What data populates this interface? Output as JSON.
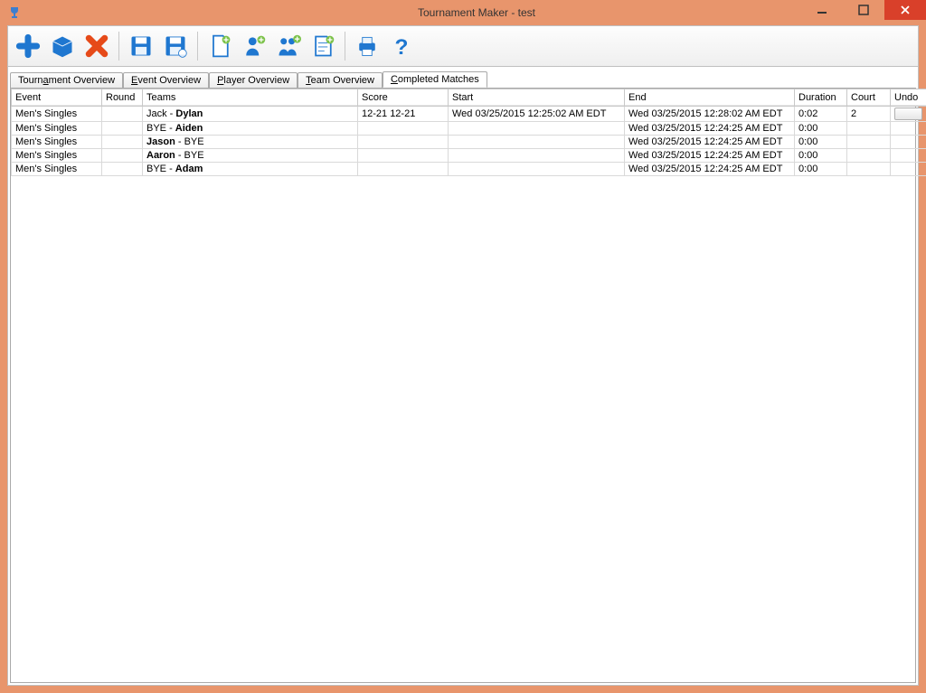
{
  "window": {
    "title": "Tournament Maker - test"
  },
  "toolbar": {
    "new_label": "New",
    "open_label": "Open",
    "delete_label": "Delete",
    "save_label": "Save",
    "save_as_label": "Save As",
    "new_doc_label": "New Document",
    "add_person_label": "Add Player",
    "add_team_label": "Add Team",
    "add_event_label": "Add Event",
    "print_label": "Print",
    "help_label": "Help"
  },
  "tabs": [
    {
      "label_pre": "Tourn",
      "label_ul": "a",
      "label_post": "ment Overview"
    },
    {
      "label_pre": "",
      "label_ul": "E",
      "label_post": "vent Overview"
    },
    {
      "label_pre": "",
      "label_ul": "P",
      "label_post": "layer Overview"
    },
    {
      "label_pre": "",
      "label_ul": "T",
      "label_post": "eam Overview"
    },
    {
      "label_pre": "",
      "label_ul": "C",
      "label_post": "ompleted Matches"
    }
  ],
  "active_tab_index": 4,
  "columns": {
    "event": "Event",
    "round": "Round",
    "teams": "Teams",
    "score": "Score",
    "start": "Start",
    "end": "End",
    "duration": "Duration",
    "court": "Court",
    "undo": "Undo"
  },
  "rows": [
    {
      "event": "Men's Singles",
      "round": "",
      "loser": "Jack",
      "winner": "Dylan",
      "score": "12-21 12-21",
      "start": "Wed 03/25/2015 12:25:02 AM EDT",
      "end": "Wed 03/25/2015 12:28:02 AM EDT",
      "duration": "0:02",
      "court": "2",
      "show_undo": true,
      "winner_first": false
    },
    {
      "event": "Men's Singles",
      "round": "",
      "loser": "BYE",
      "winner": "Aiden",
      "score": "",
      "start": "",
      "end": "Wed 03/25/2015 12:24:25 AM EDT",
      "duration": "0:00",
      "court": "",
      "show_undo": false,
      "winner_first": false
    },
    {
      "event": "Men's Singles",
      "round": "",
      "loser": "BYE",
      "winner": "Jason",
      "score": "",
      "start": "",
      "end": "Wed 03/25/2015 12:24:25 AM EDT",
      "duration": "0:00",
      "court": "",
      "show_undo": false,
      "winner_first": true
    },
    {
      "event": "Men's Singles",
      "round": "",
      "loser": "BYE",
      "winner": "Aaron",
      "score": "",
      "start": "",
      "end": "Wed 03/25/2015 12:24:25 AM EDT",
      "duration": "0:00",
      "court": "",
      "show_undo": false,
      "winner_first": true
    },
    {
      "event": "Men's Singles",
      "round": "",
      "loser": "BYE",
      "winner": "Adam",
      "score": "",
      "start": "",
      "end": "Wed 03/25/2015 12:24:25 AM EDT",
      "duration": "0:00",
      "court": "",
      "show_undo": false,
      "winner_first": false
    }
  ]
}
